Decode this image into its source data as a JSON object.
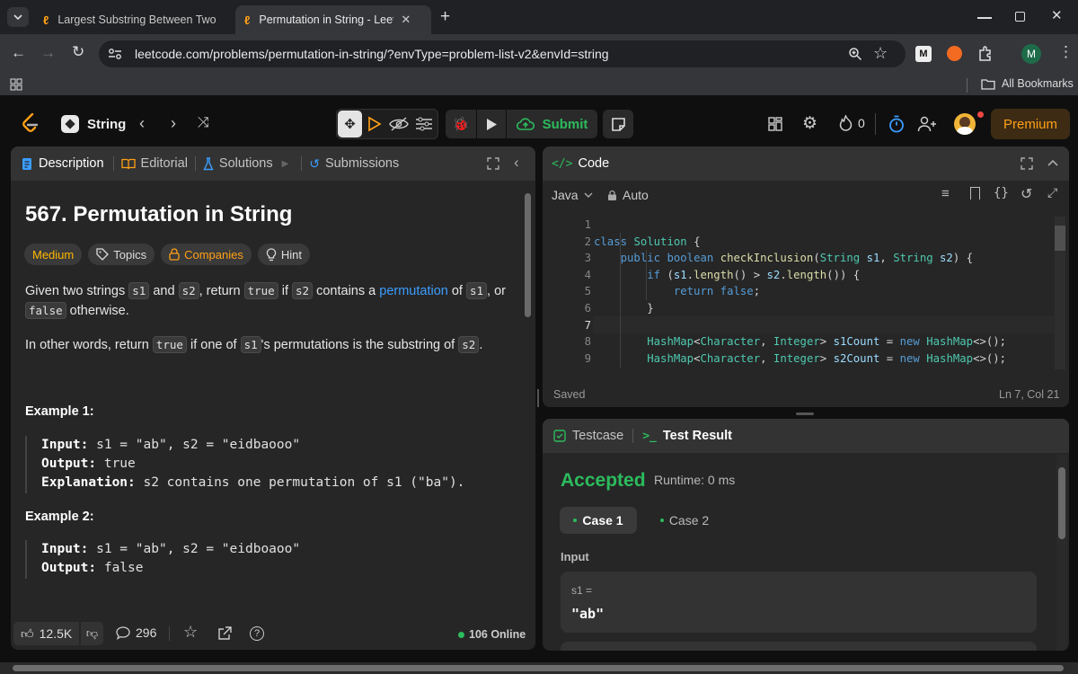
{
  "browser": {
    "tabs": [
      {
        "title": "Largest Substring Between Two"
      },
      {
        "title": "Permutation in String - LeetCode"
      }
    ],
    "url": "leetcode.com/problems/permutation-in-string/?envType=problem-list-v2&envId=string",
    "bookmarks_label": "All Bookmarks",
    "profile_initial": "M",
    "ext_m": "M"
  },
  "lc": {
    "list_name": "String",
    "submit_label": "Submit",
    "streak_count": "0",
    "premium_label": "Premium"
  },
  "left": {
    "tabs": {
      "description": "Description",
      "editorial": "Editorial",
      "solutions": "Solutions",
      "submissions": "Submissions"
    },
    "title": "567. Permutation in String",
    "difficulty": "Medium",
    "tags": {
      "topics": "Topics",
      "companies": "Companies",
      "hint": "Hint"
    },
    "p1": {
      "a": "Given two strings ",
      "s1": "s1",
      "b": " and ",
      "s2": "s2",
      "c": ", return ",
      "true": "true",
      "d": " if ",
      "s2b": "s2",
      "e": " contains a ",
      "link": "permutation",
      "f": " of ",
      "s1b": "s1",
      "g": ", or",
      "false": "false",
      "h": " otherwise."
    },
    "p2": {
      "a": "In other words, return ",
      "true": "true",
      "b": " if one of ",
      "s1": "s1",
      "c": "'s permutations is the substring of ",
      "s2": "s2",
      "d": "."
    },
    "ex1": {
      "heading": "Example 1:",
      "in_k": "Input:",
      "in_v": " s1 = \"ab\", s2 = \"eidbaooo\"",
      "out_k": "Output:",
      "out_v": " true",
      "exp_k": "Explanation:",
      "exp_v": " s2 contains one permutation of s1 (\"ba\")."
    },
    "ex2": {
      "heading": "Example 2:",
      "in_k": "Input:",
      "in_v": " s1 = \"ab\", s2 = \"eidboaoo\"",
      "out_k": "Output:",
      "out_v": " false"
    },
    "footer": {
      "likes": "12.5K",
      "comments": "296",
      "online": "106 Online"
    }
  },
  "code": {
    "title": "Code",
    "language": "Java",
    "mode": "Auto",
    "status": "Saved",
    "cursor": "Ln 7, Col 21",
    "line_numbers": [
      "1",
      "2",
      "3",
      "4",
      "5",
      "6",
      "7",
      "8",
      "9"
    ]
  },
  "result": {
    "tab_testcase": "Testcase",
    "tab_result": "Test Result",
    "verdict": "Accepted",
    "runtime": "Runtime: 0 ms",
    "case1": "Case 1",
    "case2": "Case 2",
    "input_label": "Input",
    "var_label": "s1 =",
    "var_value": "\"ab\""
  },
  "colors": {
    "accent": "#ffa116",
    "accepted": "#2cbb5d",
    "link": "#3b9dff",
    "submit": "#2cbb5d"
  }
}
